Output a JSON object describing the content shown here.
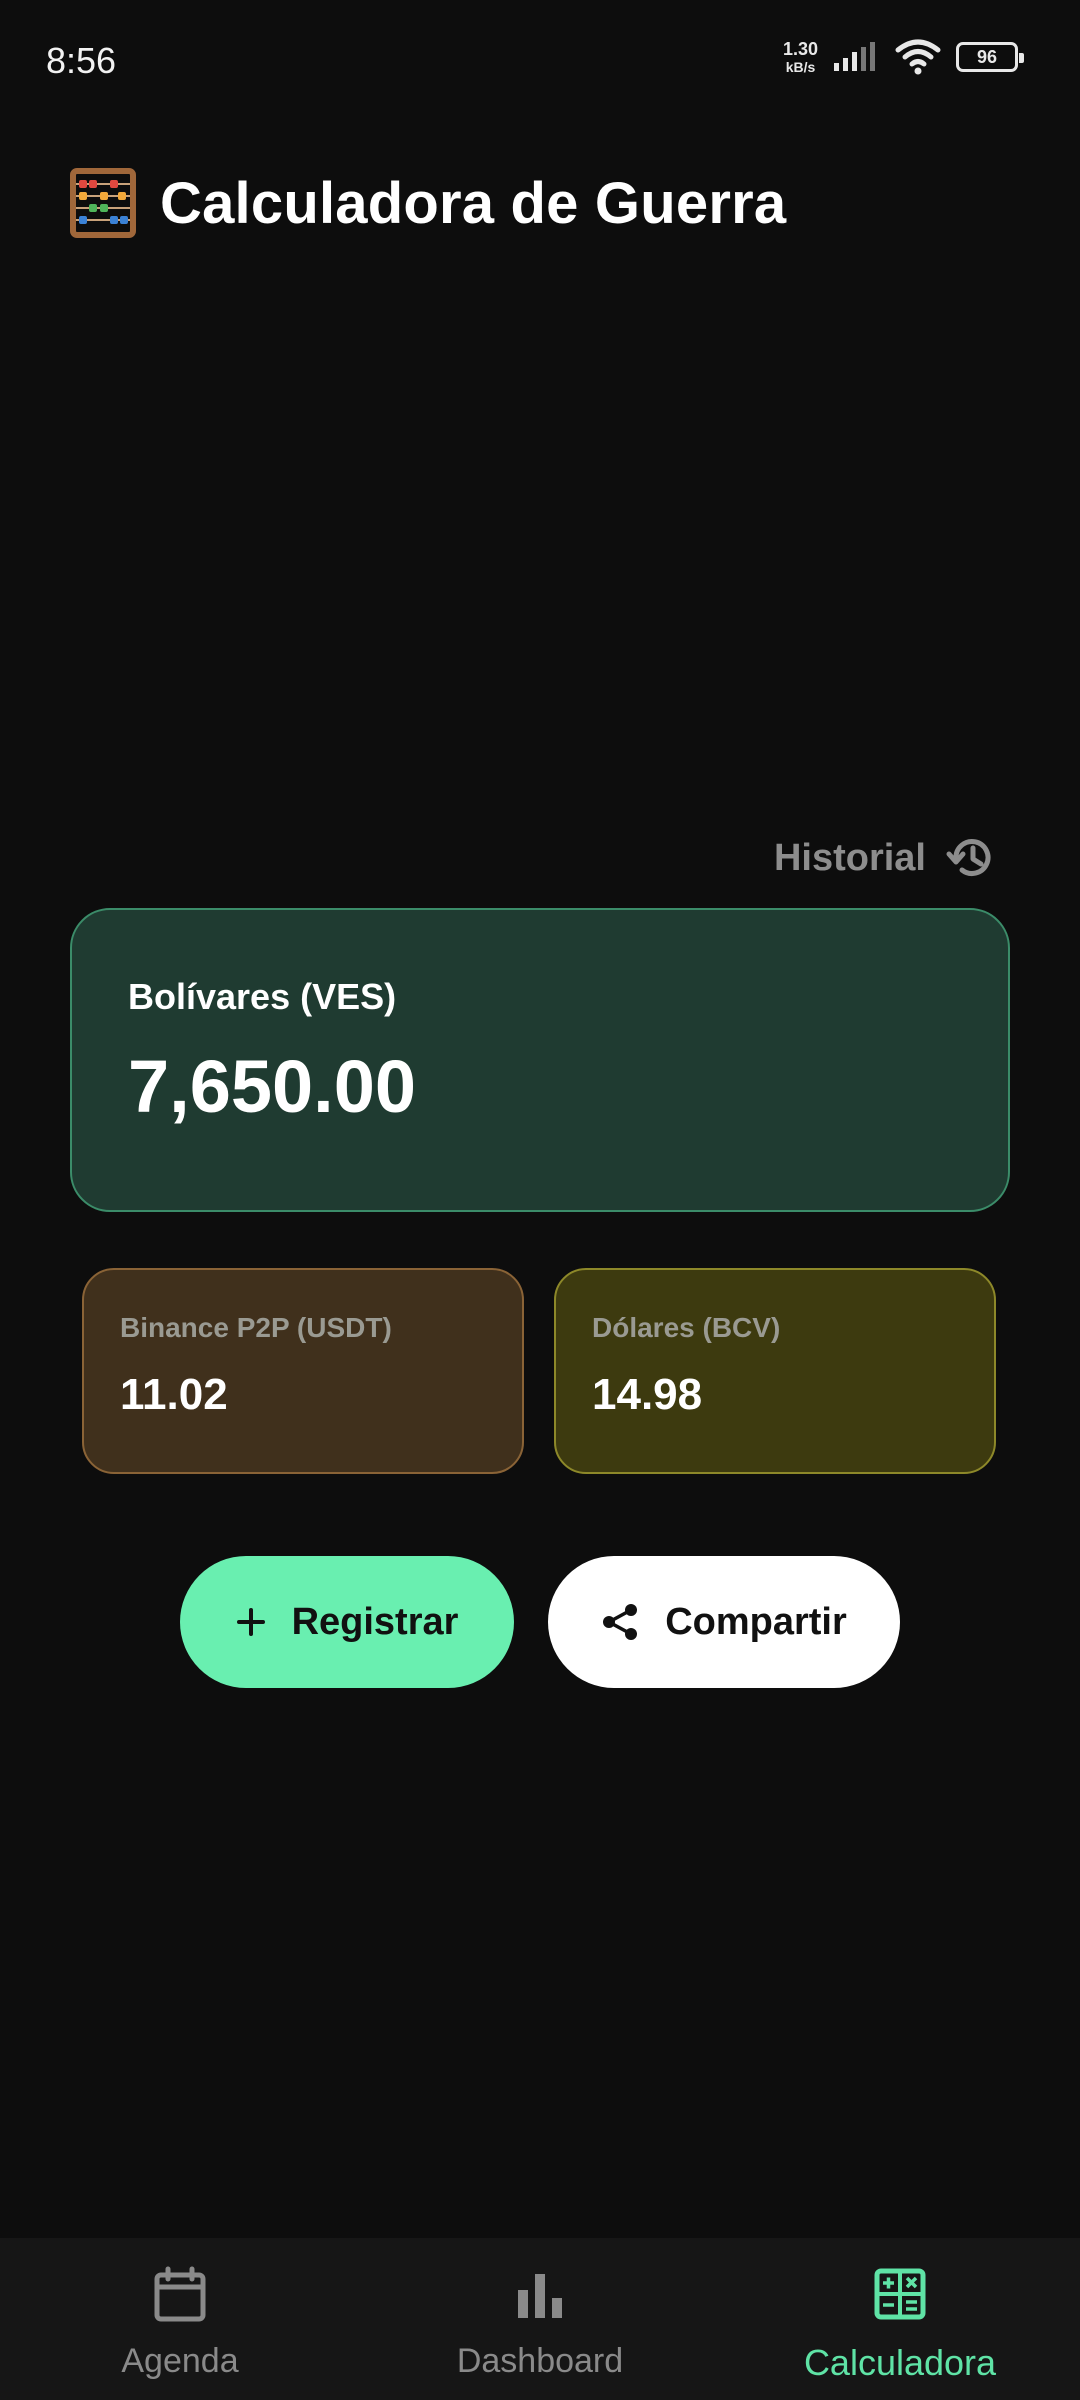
{
  "status_bar": {
    "time": "8:56",
    "net_speed_value": "1.30",
    "net_speed_unit": "kB/s",
    "battery": "96"
  },
  "header": {
    "icon": "abacus-icon",
    "title": "Calculadora de Guerra"
  },
  "history": {
    "label": "Historial",
    "icon": "history-icon"
  },
  "ves_card": {
    "label": "Bolívares (VES)",
    "value": "7,650.00",
    "color": "#1f3b31"
  },
  "rate_cards": [
    {
      "label": "Binance P2P (USDT)",
      "value": "11.02",
      "color": "#40301c"
    },
    {
      "label": "Dólares (BCV)",
      "value": "14.98",
      "color": "#3d3a0f"
    }
  ],
  "actions": {
    "register_label": "Registrar",
    "register_icon": "plus-icon",
    "share_label": "Compartir",
    "share_icon": "share-icon",
    "accent": "#69efb0"
  },
  "bottom_nav": {
    "items": [
      {
        "label": "Agenda",
        "icon": "calendar-icon",
        "active": false
      },
      {
        "label": "Dashboard",
        "icon": "bar-chart-icon",
        "active": false
      },
      {
        "label": "Calculadora",
        "icon": "calculator-icon",
        "active": true
      }
    ],
    "active_color": "#5fe3a6"
  }
}
